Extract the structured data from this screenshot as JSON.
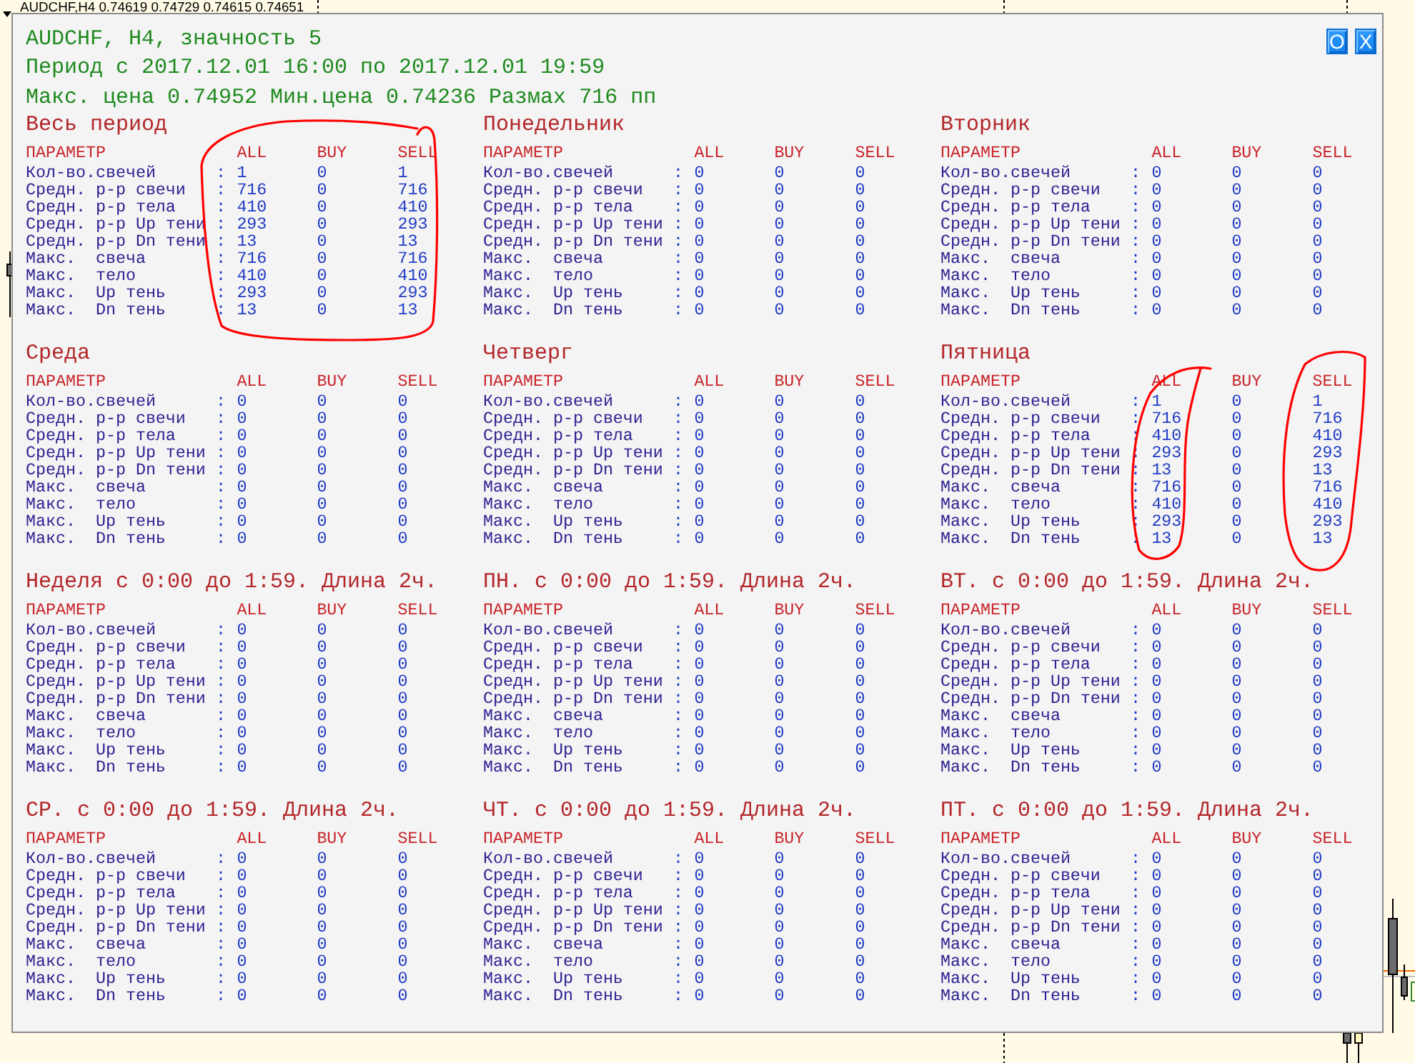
{
  "chart": {
    "symbol_label": "AUDCHF,H4 0.74619 0.74729 0.74615 0.74651"
  },
  "panel": {
    "header_lines": [
      "AUDCHF, H4, значность 5",
      "Период с 2017.12.01 16:00 по 2017.12.01 19:59",
      "Макс. цена 0.74952 Мин.цена 0.74236 Размах 716 пп"
    ],
    "buttons": [
      {
        "label": "O"
      },
      {
        "label": "X"
      }
    ],
    "sections": [
      {
        "title": "Весь период",
        "columns": [
          "ПАРАМЕТР",
          "ALL",
          "BUY",
          "SELL"
        ],
        "rows": [
          {
            "label": "Кол-во.свечей",
            "sep": ":",
            "values": [
              "1",
              "0",
              "1"
            ]
          },
          {
            "label": "Средн. р-р свечи",
            "sep": ":",
            "values": [
              "716",
              "0",
              "716"
            ]
          },
          {
            "label": "Средн. р-р тела",
            "sep": ":",
            "values": [
              "410",
              "0",
              "410"
            ]
          },
          {
            "label": "Средн. р-р Up тени",
            "sep": ":",
            "values": [
              "293",
              "0",
              "293"
            ]
          },
          {
            "label": "Средн. р-р Dn тени",
            "sep": ":",
            "values": [
              "13",
              "0",
              "13"
            ]
          },
          {
            "label": "Макс.  свеча",
            "sep": ":",
            "values": [
              "716",
              "0",
              "716"
            ]
          },
          {
            "label": "Макс.  тело",
            "sep": ":",
            "values": [
              "410",
              "0",
              "410"
            ]
          },
          {
            "label": "Макс.  Up тень",
            "sep": ":",
            "values": [
              "293",
              "0",
              "293"
            ]
          },
          {
            "label": "Макс.  Dn тень",
            "sep": ":",
            "values": [
              "13",
              "0",
              "13"
            ]
          }
        ]
      },
      {
        "title": "Понедельник",
        "columns": [
          "ПАРАМЕТР",
          "ALL",
          "BUY",
          "SELL"
        ],
        "rows": [
          {
            "label": "Кол-во.свечей",
            "sep": ":",
            "values": [
              "0",
              "0",
              "0"
            ]
          },
          {
            "label": "Средн. р-р свечи",
            "sep": ":",
            "values": [
              "0",
              "0",
              "0"
            ]
          },
          {
            "label": "Средн. р-р тела",
            "sep": ":",
            "values": [
              "0",
              "0",
              "0"
            ]
          },
          {
            "label": "Средн. р-р Up тени",
            "sep": ":",
            "values": [
              "0",
              "0",
              "0"
            ]
          },
          {
            "label": "Средн. р-р Dn тени",
            "sep": ":",
            "values": [
              "0",
              "0",
              "0"
            ]
          },
          {
            "label": "Макс.  свеча",
            "sep": ":",
            "values": [
              "0",
              "0",
              "0"
            ]
          },
          {
            "label": "Макс.  тело",
            "sep": ":",
            "values": [
              "0",
              "0",
              "0"
            ]
          },
          {
            "label": "Макс.  Up тень",
            "sep": ":",
            "values": [
              "0",
              "0",
              "0"
            ]
          },
          {
            "label": "Макс.  Dn тень",
            "sep": ":",
            "values": [
              "0",
              "0",
              "0"
            ]
          }
        ]
      },
      {
        "title": "Вторник",
        "columns": [
          "ПАРАМЕТР",
          "ALL",
          "BUY",
          "SELL"
        ],
        "rows": [
          {
            "label": "Кол-во.свечей",
            "sep": ":",
            "values": [
              "0",
              "0",
              "0"
            ]
          },
          {
            "label": "Средн. р-р свечи",
            "sep": ":",
            "values": [
              "0",
              "0",
              "0"
            ]
          },
          {
            "label": "Средн. р-р тела",
            "sep": ":",
            "values": [
              "0",
              "0",
              "0"
            ]
          },
          {
            "label": "Средн. р-р Up тени",
            "sep": ":",
            "values": [
              "0",
              "0",
              "0"
            ]
          },
          {
            "label": "Средн. р-р Dn тени",
            "sep": ":",
            "values": [
              "0",
              "0",
              "0"
            ]
          },
          {
            "label": "Макс.  свеча",
            "sep": ":",
            "values": [
              "0",
              "0",
              "0"
            ]
          },
          {
            "label": "Макс.  тело",
            "sep": ":",
            "values": [
              "0",
              "0",
              "0"
            ]
          },
          {
            "label": "Макс.  Up тень",
            "sep": ":",
            "values": [
              "0",
              "0",
              "0"
            ]
          },
          {
            "label": "Макс.  Dn тень",
            "sep": ":",
            "values": [
              "0",
              "0",
              "0"
            ]
          }
        ]
      },
      {
        "title": "Среда",
        "columns": [
          "ПАРАМЕТР",
          "ALL",
          "BUY",
          "SELL"
        ],
        "rows": [
          {
            "label": "Кол-во.свечей",
            "sep": ":",
            "values": [
              "0",
              "0",
              "0"
            ]
          },
          {
            "label": "Средн. р-р свечи",
            "sep": ":",
            "values": [
              "0",
              "0",
              "0"
            ]
          },
          {
            "label": "Средн. р-р тела",
            "sep": ":",
            "values": [
              "0",
              "0",
              "0"
            ]
          },
          {
            "label": "Средн. р-р Up тени",
            "sep": ":",
            "values": [
              "0",
              "0",
              "0"
            ]
          },
          {
            "label": "Средн. р-р Dn тени",
            "sep": ":",
            "values": [
              "0",
              "0",
              "0"
            ]
          },
          {
            "label": "Макс.  свеча",
            "sep": ":",
            "values": [
              "0",
              "0",
              "0"
            ]
          },
          {
            "label": "Макс.  тело",
            "sep": ":",
            "values": [
              "0",
              "0",
              "0"
            ]
          },
          {
            "label": "Макс.  Up тень",
            "sep": ":",
            "values": [
              "0",
              "0",
              "0"
            ]
          },
          {
            "label": "Макс.  Dn тень",
            "sep": ":",
            "values": [
              "0",
              "0",
              "0"
            ]
          }
        ]
      },
      {
        "title": "Четверг",
        "columns": [
          "ПАРАМЕТР",
          "ALL",
          "BUY",
          "SELL"
        ],
        "rows": [
          {
            "label": "Кол-во.свечей",
            "sep": ":",
            "values": [
              "0",
              "0",
              "0"
            ]
          },
          {
            "label": "Средн. р-р свечи",
            "sep": ":",
            "values": [
              "0",
              "0",
              "0"
            ]
          },
          {
            "label": "Средн. р-р тела",
            "sep": ":",
            "values": [
              "0",
              "0",
              "0"
            ]
          },
          {
            "label": "Средн. р-р Up тени",
            "sep": ":",
            "values": [
              "0",
              "0",
              "0"
            ]
          },
          {
            "label": "Средн. р-р Dn тени",
            "sep": ":",
            "values": [
              "0",
              "0",
              "0"
            ]
          },
          {
            "label": "Макс.  свеча",
            "sep": ":",
            "values": [
              "0",
              "0",
              "0"
            ]
          },
          {
            "label": "Макс.  тело",
            "sep": ":",
            "values": [
              "0",
              "0",
              "0"
            ]
          },
          {
            "label": "Макс.  Up тень",
            "sep": ":",
            "values": [
              "0",
              "0",
              "0"
            ]
          },
          {
            "label": "Макс.  Dn тень",
            "sep": ":",
            "values": [
              "0",
              "0",
              "0"
            ]
          }
        ]
      },
      {
        "title": "Пятница",
        "columns": [
          "ПАРАМЕТР",
          "ALL",
          "BUY",
          "SELL"
        ],
        "rows": [
          {
            "label": "Кол-во.свечей",
            "sep": ":",
            "values": [
              "1",
              "0",
              "1"
            ]
          },
          {
            "label": "Средн. р-р свечи",
            "sep": ":",
            "values": [
              "716",
              "0",
              "716"
            ]
          },
          {
            "label": "Средн. р-р тела",
            "sep": ":",
            "values": [
              "410",
              "0",
              "410"
            ]
          },
          {
            "label": "Средн. р-р Up тени",
            "sep": ":",
            "values": [
              "293",
              "0",
              "293"
            ]
          },
          {
            "label": "Средн. р-р Dn тени",
            "sep": ":",
            "values": [
              "13",
              "0",
              "13"
            ]
          },
          {
            "label": "Макс.  свеча",
            "sep": ":",
            "values": [
              "716",
              "0",
              "716"
            ]
          },
          {
            "label": "Макс.  тело",
            "sep": ":",
            "values": [
              "410",
              "0",
              "410"
            ]
          },
          {
            "label": "Макс.  Up тень",
            "sep": ":",
            "values": [
              "293",
              "0",
              "293"
            ]
          },
          {
            "label": "Макс.  Dn тень",
            "sep": ":",
            "values": [
              "13",
              "0",
              "13"
            ]
          }
        ]
      },
      {
        "title": "Неделя с 0:00 до 1:59. Длина 2ч.",
        "columns": [
          "ПАРАМЕТР",
          "ALL",
          "BUY",
          "SELL"
        ],
        "rows": [
          {
            "label": "Кол-во.свечей",
            "sep": ":",
            "values": [
              "0",
              "0",
              "0"
            ]
          },
          {
            "label": "Средн. р-р свечи",
            "sep": ":",
            "values": [
              "0",
              "0",
              "0"
            ]
          },
          {
            "label": "Средн. р-р тела",
            "sep": ":",
            "values": [
              "0",
              "0",
              "0"
            ]
          },
          {
            "label": "Средн. р-р Up тени",
            "sep": ":",
            "values": [
              "0",
              "0",
              "0"
            ]
          },
          {
            "label": "Средн. р-р Dn тени",
            "sep": ":",
            "values": [
              "0",
              "0",
              "0"
            ]
          },
          {
            "label": "Макс.  свеча",
            "sep": ":",
            "values": [
              "0",
              "0",
              "0"
            ]
          },
          {
            "label": "Макс.  тело",
            "sep": ":",
            "values": [
              "0",
              "0",
              "0"
            ]
          },
          {
            "label": "Макс.  Up тень",
            "sep": ":",
            "values": [
              "0",
              "0",
              "0"
            ]
          },
          {
            "label": "Макс.  Dn тень",
            "sep": ":",
            "values": [
              "0",
              "0",
              "0"
            ]
          }
        ]
      },
      {
        "title": "ПН. с 0:00 до 1:59. Длина 2ч.",
        "columns": [
          "ПАРАМЕТР",
          "ALL",
          "BUY",
          "SELL"
        ],
        "rows": [
          {
            "label": "Кол-во.свечей",
            "sep": ":",
            "values": [
              "0",
              "0",
              "0"
            ]
          },
          {
            "label": "Средн. р-р свечи",
            "sep": ":",
            "values": [
              "0",
              "0",
              "0"
            ]
          },
          {
            "label": "Средн. р-р тела",
            "sep": ":",
            "values": [
              "0",
              "0",
              "0"
            ]
          },
          {
            "label": "Средн. р-р Up тени",
            "sep": ":",
            "values": [
              "0",
              "0",
              "0"
            ]
          },
          {
            "label": "Средн. р-р Dn тени",
            "sep": ":",
            "values": [
              "0",
              "0",
              "0"
            ]
          },
          {
            "label": "Макс.  свеча",
            "sep": ":",
            "values": [
              "0",
              "0",
              "0"
            ]
          },
          {
            "label": "Макс.  тело",
            "sep": ":",
            "values": [
              "0",
              "0",
              "0"
            ]
          },
          {
            "label": "Макс.  Up тень",
            "sep": ":",
            "values": [
              "0",
              "0",
              "0"
            ]
          },
          {
            "label": "Макс.  Dn тень",
            "sep": ":",
            "values": [
              "0",
              "0",
              "0"
            ]
          }
        ]
      },
      {
        "title": "ВТ. с 0:00 до 1:59. Длина 2ч.",
        "columns": [
          "ПАРАМЕТР",
          "ALL",
          "BUY",
          "SELL"
        ],
        "rows": [
          {
            "label": "Кол-во.свечей",
            "sep": ":",
            "values": [
              "0",
              "0",
              "0"
            ]
          },
          {
            "label": "Средн. р-р свечи",
            "sep": ":",
            "values": [
              "0",
              "0",
              "0"
            ]
          },
          {
            "label": "Средн. р-р тела",
            "sep": ":",
            "values": [
              "0",
              "0",
              "0"
            ]
          },
          {
            "label": "Средн. р-р Up тени",
            "sep": ":",
            "values": [
              "0",
              "0",
              "0"
            ]
          },
          {
            "label": "Средн. р-р Dn тени",
            "sep": ":",
            "values": [
              "0",
              "0",
              "0"
            ]
          },
          {
            "label": "Макс.  свеча",
            "sep": ":",
            "values": [
              "0",
              "0",
              "0"
            ]
          },
          {
            "label": "Макс.  тело",
            "sep": ":",
            "values": [
              "0",
              "0",
              "0"
            ]
          },
          {
            "label": "Макс.  Up тень",
            "sep": ":",
            "values": [
              "0",
              "0",
              "0"
            ]
          },
          {
            "label": "Макс.  Dn тень",
            "sep": ":",
            "values": [
              "0",
              "0",
              "0"
            ]
          }
        ]
      },
      {
        "title": "СР. с 0:00 до 1:59. Длина 2ч.",
        "columns": [
          "ПАРАМЕТР",
          "ALL",
          "BUY",
          "SELL"
        ],
        "rows": [
          {
            "label": "Кол-во.свечей",
            "sep": ":",
            "values": [
              "0",
              "0",
              "0"
            ]
          },
          {
            "label": "Средн. р-р свечи",
            "sep": ":",
            "values": [
              "0",
              "0",
              "0"
            ]
          },
          {
            "label": "Средн. р-р тела",
            "sep": ":",
            "values": [
              "0",
              "0",
              "0"
            ]
          },
          {
            "label": "Средн. р-р Up тени",
            "sep": ":",
            "values": [
              "0",
              "0",
              "0"
            ]
          },
          {
            "label": "Средн. р-р Dn тени",
            "sep": ":",
            "values": [
              "0",
              "0",
              "0"
            ]
          },
          {
            "label": "Макс.  свеча",
            "sep": ":",
            "values": [
              "0",
              "0",
              "0"
            ]
          },
          {
            "label": "Макс.  тело",
            "sep": ":",
            "values": [
              "0",
              "0",
              "0"
            ]
          },
          {
            "label": "Макс.  Up тень",
            "sep": ":",
            "values": [
              "0",
              "0",
              "0"
            ]
          },
          {
            "label": "Макс.  Dn тень",
            "sep": ":",
            "values": [
              "0",
              "0",
              "0"
            ]
          }
        ]
      },
      {
        "title": "ЧТ. с 0:00 до 1:59. Длина 2ч.",
        "columns": [
          "ПАРАМЕТР",
          "ALL",
          "BUY",
          "SELL"
        ],
        "rows": [
          {
            "label": "Кол-во.свечей",
            "sep": ":",
            "values": [
              "0",
              "0",
              "0"
            ]
          },
          {
            "label": "Средн. р-р свечи",
            "sep": ":",
            "values": [
              "0",
              "0",
              "0"
            ]
          },
          {
            "label": "Средн. р-р тела",
            "sep": ":",
            "values": [
              "0",
              "0",
              "0"
            ]
          },
          {
            "label": "Средн. р-р Up тени",
            "sep": ":",
            "values": [
              "0",
              "0",
              "0"
            ]
          },
          {
            "label": "Средн. р-р Dn тени",
            "sep": ":",
            "values": [
              "0",
              "0",
              "0"
            ]
          },
          {
            "label": "Макс.  свеча",
            "sep": ":",
            "values": [
              "0",
              "0",
              "0"
            ]
          },
          {
            "label": "Макс.  тело",
            "sep": ":",
            "values": [
              "0",
              "0",
              "0"
            ]
          },
          {
            "label": "Макс.  Up тень",
            "sep": ":",
            "values": [
              "0",
              "0",
              "0"
            ]
          },
          {
            "label": "Макс.  Dn тень",
            "sep": ":",
            "values": [
              "0",
              "0",
              "0"
            ]
          }
        ]
      },
      {
        "title": "ПТ. с 0:00 до 1:59. Длина 2ч.",
        "columns": [
          "ПАРАМЕТР",
          "ALL",
          "BUY",
          "SELL"
        ],
        "rows": [
          {
            "label": "Кол-во.свечей",
            "sep": ":",
            "values": [
              "0",
              "0",
              "0"
            ]
          },
          {
            "label": "Средн. р-р свечи",
            "sep": ":",
            "values": [
              "0",
              "0",
              "0"
            ]
          },
          {
            "label": "Средн. р-р тела",
            "sep": ":",
            "values": [
              "0",
              "0",
              "0"
            ]
          },
          {
            "label": "Средн. р-р Up тени",
            "sep": ":",
            "values": [
              "0",
              "0",
              "0"
            ]
          },
          {
            "label": "Средн. р-р Dn тени",
            "sep": ":",
            "values": [
              "0",
              "0",
              "0"
            ]
          },
          {
            "label": "Макс.  свеча",
            "sep": ":",
            "values": [
              "0",
              "0",
              "0"
            ]
          },
          {
            "label": "Макс.  тело",
            "sep": ":",
            "values": [
              "0",
              "0",
              "0"
            ]
          },
          {
            "label": "Макс.  Up тень",
            "sep": ":",
            "values": [
              "0",
              "0",
              "0"
            ]
          },
          {
            "label": "Макс.  Dn тень",
            "sep": ":",
            "values": [
              "0",
              "0",
              "0"
            ]
          }
        ]
      }
    ]
  }
}
